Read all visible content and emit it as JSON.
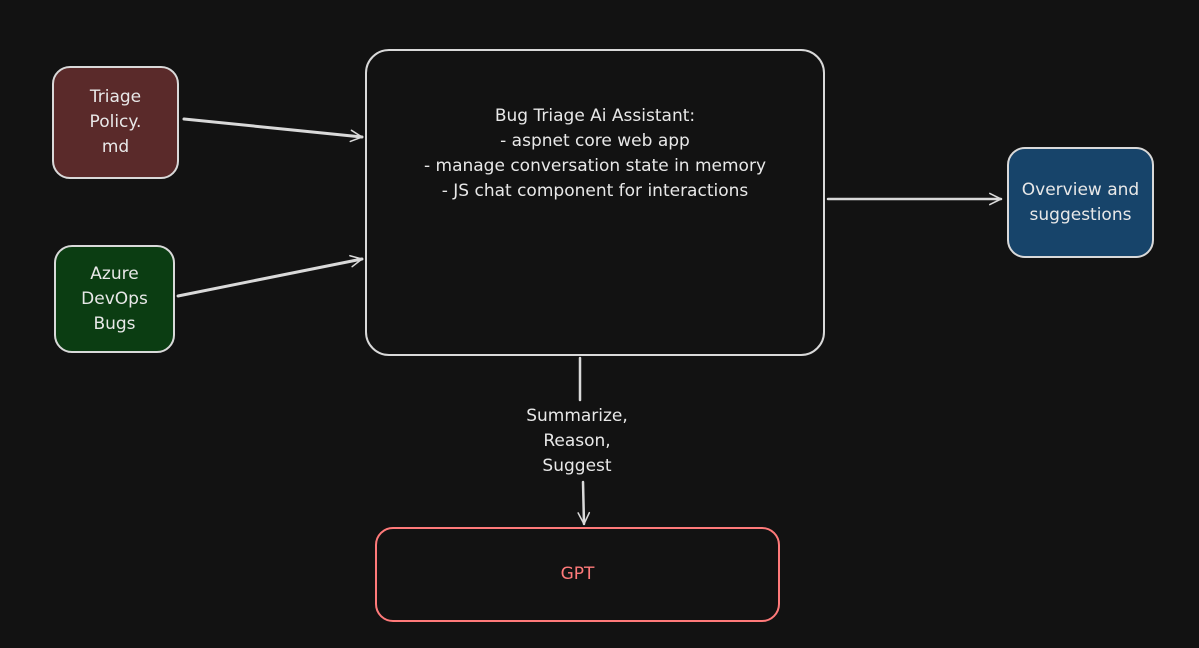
{
  "colors": {
    "background": "#121212",
    "stroke": "#d9d9d9",
    "triage_fill": "#5a2a2a",
    "azure_fill": "#0b3d12",
    "overview_fill": "#17446a",
    "gpt_stroke": "#ff7a7a"
  },
  "nodes": {
    "triage_policy": {
      "lines": [
        "Triage",
        "Policy.",
        "md"
      ]
    },
    "azure_devops": {
      "lines": [
        "Azure",
        "DevOps",
        "Bugs"
      ]
    },
    "assistant": {
      "lines": [
        "Bug Triage Ai Assistant:",
        "- aspnet core web app",
        "- manage conversation state in memory",
        "- JS chat component for interactions"
      ]
    },
    "overview": {
      "lines": [
        "Overview and",
        "suggestions"
      ]
    },
    "gpt": {
      "label": "GPT"
    }
  },
  "edges": {
    "gpt_label": {
      "lines": [
        "Summarize,",
        "Reason,",
        "Suggest"
      ]
    }
  }
}
